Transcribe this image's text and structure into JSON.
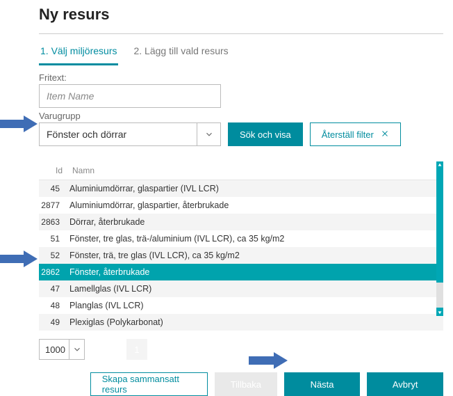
{
  "title": "Ny resurs",
  "tabs": {
    "active": "1. Välj miljöresurs",
    "inactive": "2. Lägg till vald resurs"
  },
  "freetext": {
    "label": "Fritext:",
    "placeholder": "Item Name"
  },
  "varugrupp": {
    "label": "Varugrupp",
    "value": "Fönster och dörrar"
  },
  "buttons": {
    "search": "Sök och visa",
    "reset": "Återställ filter",
    "compose": "Skapa sammansatt resurs",
    "back": "Tillbaka",
    "next": "Nästa",
    "cancel": "Avbryt"
  },
  "table": {
    "columns": {
      "id": "Id",
      "name": "Namn"
    },
    "rows": [
      {
        "id": "45",
        "name": "Aluminiumdörrar, glaspartier (IVL LCR)"
      },
      {
        "id": "2877",
        "name": "Aluminiumdörrar, glaspartier, återbrukade"
      },
      {
        "id": "2863",
        "name": "Dörrar, återbrukade"
      },
      {
        "id": "51",
        "name": "Fönster,  tre glas, trä-/aluminium (IVL LCR), ca 35 kg/m2"
      },
      {
        "id": "52",
        "name": "Fönster, trä, tre glas (IVL LCR), ca 35 kg/m2"
      },
      {
        "id": "2862",
        "name": "Fönster, återbrukade"
      },
      {
        "id": "47",
        "name": "Lamellglas (IVL LCR)"
      },
      {
        "id": "48",
        "name": "Planglas (IVL LCR)"
      },
      {
        "id": "49",
        "name": "Plexiglas (Polykarbonat)"
      }
    ],
    "selected_index": 5
  },
  "pager": {
    "page_size": "1000",
    "page": "1"
  }
}
